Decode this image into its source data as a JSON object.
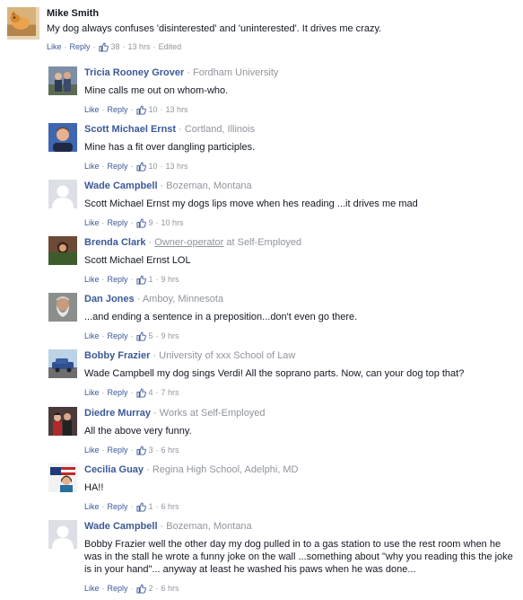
{
  "top_comment": {
    "author": "Mike Smith",
    "text": "My dog always confuses 'disinterested' and 'uninterested'. It drives me crazy.",
    "like_label": "Like",
    "reply_label": "Reply",
    "likes": "38",
    "time": "13 hrs",
    "edited": "Edited"
  },
  "replies": [
    {
      "author": "Tricia Rooney Grover",
      "meta_prefix": "",
      "meta": "Fordham University",
      "meta_suffix": "",
      "text": "Mine calls me out on whom-who.",
      "like_label": "Like",
      "reply_label": "Reply",
      "likes": "10",
      "time": "13 hrs",
      "avatar": "photo-couple"
    },
    {
      "author": "Scott Michael Ernst",
      "meta_prefix": "",
      "meta": "Cortland, Illinois",
      "meta_suffix": "",
      "text": "Mine has a fit over dangling participles.",
      "like_label": "Like",
      "reply_label": "Reply",
      "likes": "10",
      "time": "13 hrs",
      "avatar": "photo-portrait"
    },
    {
      "author": "Wade Campbell",
      "meta_prefix": "",
      "meta": "Bozeman, Montana",
      "meta_suffix": "",
      "text": "Scott Michael Ernst my dogs lips move when hes reading ...it drives me mad",
      "like_label": "Like",
      "reply_label": "Reply",
      "likes": "9",
      "time": "10 hrs",
      "avatar": "default-silhouette"
    },
    {
      "author": "Brenda Clark",
      "meta_prefix": "",
      "meta": "Owner-operator",
      "meta_suffix": "at Self-Employed",
      "text": "Scott Michael Ernst LOL",
      "like_label": "Like",
      "reply_label": "Reply",
      "likes": "1",
      "time": "9 hrs",
      "avatar": "photo-outdoor"
    },
    {
      "author": "Dan Jones",
      "meta_prefix": "",
      "meta": "Amboy, Minnesota",
      "meta_suffix": "",
      "text": "...and ending a sentence in a preposition...don't even go there.",
      "like_label": "Like",
      "reply_label": "Reply",
      "likes": "5",
      "time": "9 hrs",
      "avatar": "photo-beard"
    },
    {
      "author": "Bobby Frazier",
      "meta_prefix": "",
      "meta": "University of xxx School of Law",
      "meta_suffix": "",
      "text": "Wade Campbell my dog sings Verdi! All the soprano parts. Now, can your dog top that?",
      "like_label": "Like",
      "reply_label": "Reply",
      "likes": "4",
      "time": "7 hrs",
      "avatar": "photo-car"
    },
    {
      "author": "Diedre Murray",
      "meta_prefix": "",
      "meta": "Works at Self-Employed",
      "meta_suffix": "",
      "text": "All the above very funny.",
      "like_label": "Like",
      "reply_label": "Reply",
      "likes": "3",
      "time": "6 hrs",
      "avatar": "photo-group"
    },
    {
      "author": "Cecilia Guay",
      "meta_prefix": "",
      "meta": "Regina High School, Adelphi, MD",
      "meta_suffix": "",
      "text": "HA!!",
      "like_label": "Like",
      "reply_label": "Reply",
      "likes": "1",
      "time": "6 hrs",
      "avatar": "photo-flag"
    },
    {
      "author": "Wade Campbell",
      "meta_prefix": "",
      "meta": "Bozeman, Montana",
      "meta_suffix": "",
      "text": "Bobby Frazier well the other day my dog pulled in to a gas station to use the rest room when he was in the stall he wrote a funny joke on the wall ...something about \"why you reading this the joke is in your hand\"... anyway at least he washed his paws when he was done...",
      "like_label": "Like",
      "reply_label": "Reply",
      "likes": "2",
      "time": "6 hrs",
      "avatar": "default-silhouette"
    }
  ]
}
